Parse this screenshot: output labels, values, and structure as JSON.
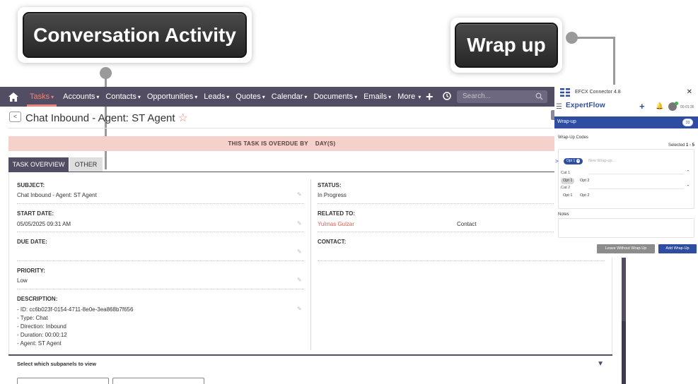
{
  "callouts": {
    "conversation": "Conversation Activity",
    "wrapup": "Wrap up"
  },
  "nav": {
    "items": [
      "Tasks",
      "Accounts",
      "Contacts",
      "Opportunities",
      "Leads",
      "Quotes",
      "Calendar",
      "Documents",
      "Emails",
      "More"
    ],
    "search_placeholder": "Search...",
    "bar_color": "#534d64",
    "active_color": "#f08377"
  },
  "record": {
    "back": "<",
    "title": "Chat Inbound - Agent: ST Agent",
    "overdue": "THIS TASK IS OVERDUE BY    DAY(S)",
    "tabs": [
      "TASK OVERVIEW",
      "OTHER"
    ],
    "fields": {
      "subject_label": "SUBJECT:",
      "subject_value": "Chat Inbound - Agent: ST Agent",
      "status_label": "STATUS:",
      "status_value": "In Progress",
      "start_label": "START DATE:",
      "start_value": "05/05/2025 09:31 AM",
      "related_label": "RELATED TO:",
      "related_value": "Yulmas Gulzar",
      "related_type": "Contact",
      "due_label": "DUE DATE:",
      "contact_label": "CONTACT:",
      "priority_label": "PRIORITY:",
      "priority_value": "Low",
      "description_label": "DESCRIPTION:",
      "description_lines": [
        "- ID: cc6b023f-0154-4711-8e0e-3ea868b7f656",
        "- Type: Chat",
        "- Direction: Inbound",
        "- Duration: 00:00:12",
        "- Agent: ST Agent"
      ]
    },
    "subpanels_label": "Select which subpanels to view"
  },
  "connector": {
    "title": "EFCX Connector 4.8",
    "brand": "ExpertFlow",
    "timer": "00:01:36",
    "wrap_header": "Wrap-up",
    "wrap_count": "33",
    "codes_label": "Wrap-Up Codes",
    "selected_label": "Selected",
    "selected_count": "1 - 5",
    "selected_chip": "Opt 1",
    "new_placeholder": "New Wrap-up...",
    "categories": [
      {
        "name": "Cat 1",
        "options": [
          "Opt 1",
          "Opt 2"
        ]
      },
      {
        "name": "Cat 2",
        "options": [
          "Opt 1",
          "Opt 2"
        ]
      }
    ],
    "notes_label": "Notes",
    "leave_button": "Leave Without Wrap-Up",
    "add_button": "Add Wrap-Up",
    "accent": "#2f4da0"
  }
}
